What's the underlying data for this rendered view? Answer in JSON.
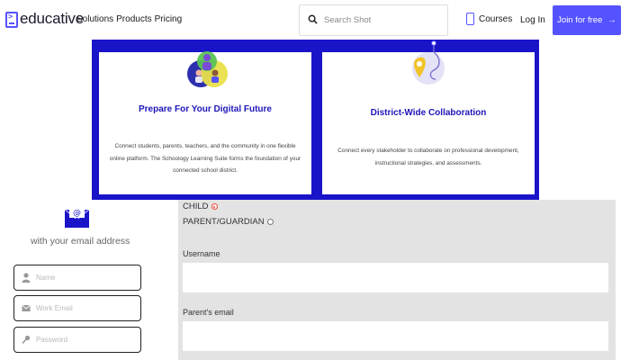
{
  "header": {
    "logo_text": "educative",
    "nav": [
      "Solutions",
      "Products",
      "Pricing"
    ],
    "search_placeholder": "Search Shot",
    "courses_label": "Courses",
    "login_label": "Log In",
    "join_label": "Join for free",
    "join_arrow": "→",
    "accent_color": "#5553ff"
  },
  "banner": {
    "background_color": "#1a14c9",
    "cards": [
      {
        "title": "Prepare For Your Digital Future",
        "description": "Connect students, parents, teachers, and the community in one flexible online platform. The Schoology Learning Suite forms the foundation of your connected school district.",
        "icon": "people-circles-illustration"
      },
      {
        "title": "District-Wide Collaboration",
        "description": "Connect every stakeholder to collaborate on professional development, instructional strategies, and assessments.",
        "icon": "map-pin-route-illustration"
      }
    ]
  },
  "signup": {
    "email_caption": "with your email address",
    "fields": [
      {
        "placeholder": "Name",
        "icon": "user-icon"
      },
      {
        "placeholder": "Work Email",
        "icon": "mail-icon"
      },
      {
        "placeholder": "Password",
        "icon": "key-icon"
      }
    ]
  },
  "form": {
    "roles": [
      {
        "label": "CHILD",
        "checked": true
      },
      {
        "label": "PARENT/GUARDIAN",
        "checked": false
      }
    ],
    "username_label": "Username",
    "parent_email_label": "Parent's email"
  }
}
